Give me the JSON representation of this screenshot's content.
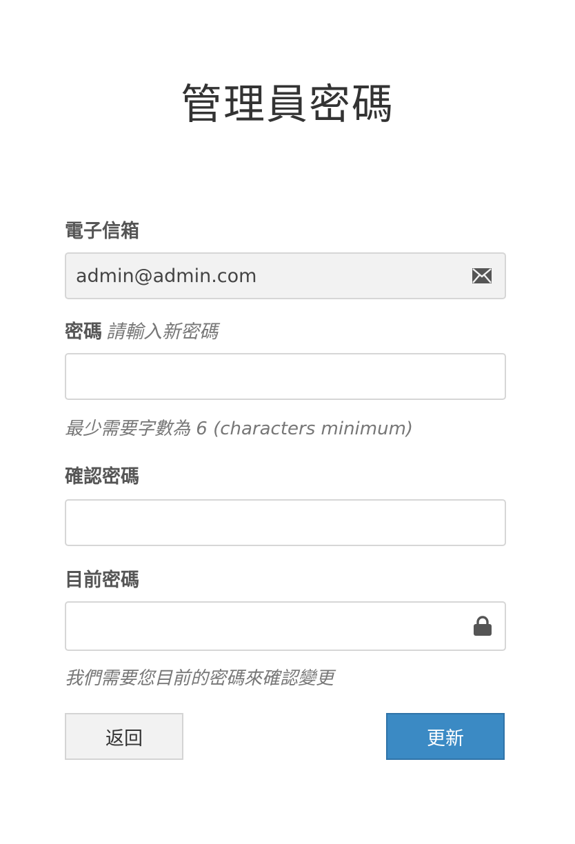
{
  "page": {
    "title": "管理員密碼"
  },
  "form": {
    "email": {
      "label": "電子信箱",
      "value": "admin@admin.com",
      "icon": "envelope-icon"
    },
    "password": {
      "label": "密碼",
      "hint": "請輸入新密碼",
      "value": "",
      "help": "最少需要字數為 6 (characters minimum)"
    },
    "confirm_password": {
      "label": "確認密碼",
      "value": ""
    },
    "current_password": {
      "label": "目前密碼",
      "value": "",
      "icon": "lock-icon",
      "help": "我們需要您目前的密碼來確認變更"
    }
  },
  "actions": {
    "back_label": "返回",
    "update_label": "更新"
  },
  "colors": {
    "primary": "#3b8ac4",
    "secondary_bg": "#f2f2f2",
    "border": "#d6d6d6"
  }
}
